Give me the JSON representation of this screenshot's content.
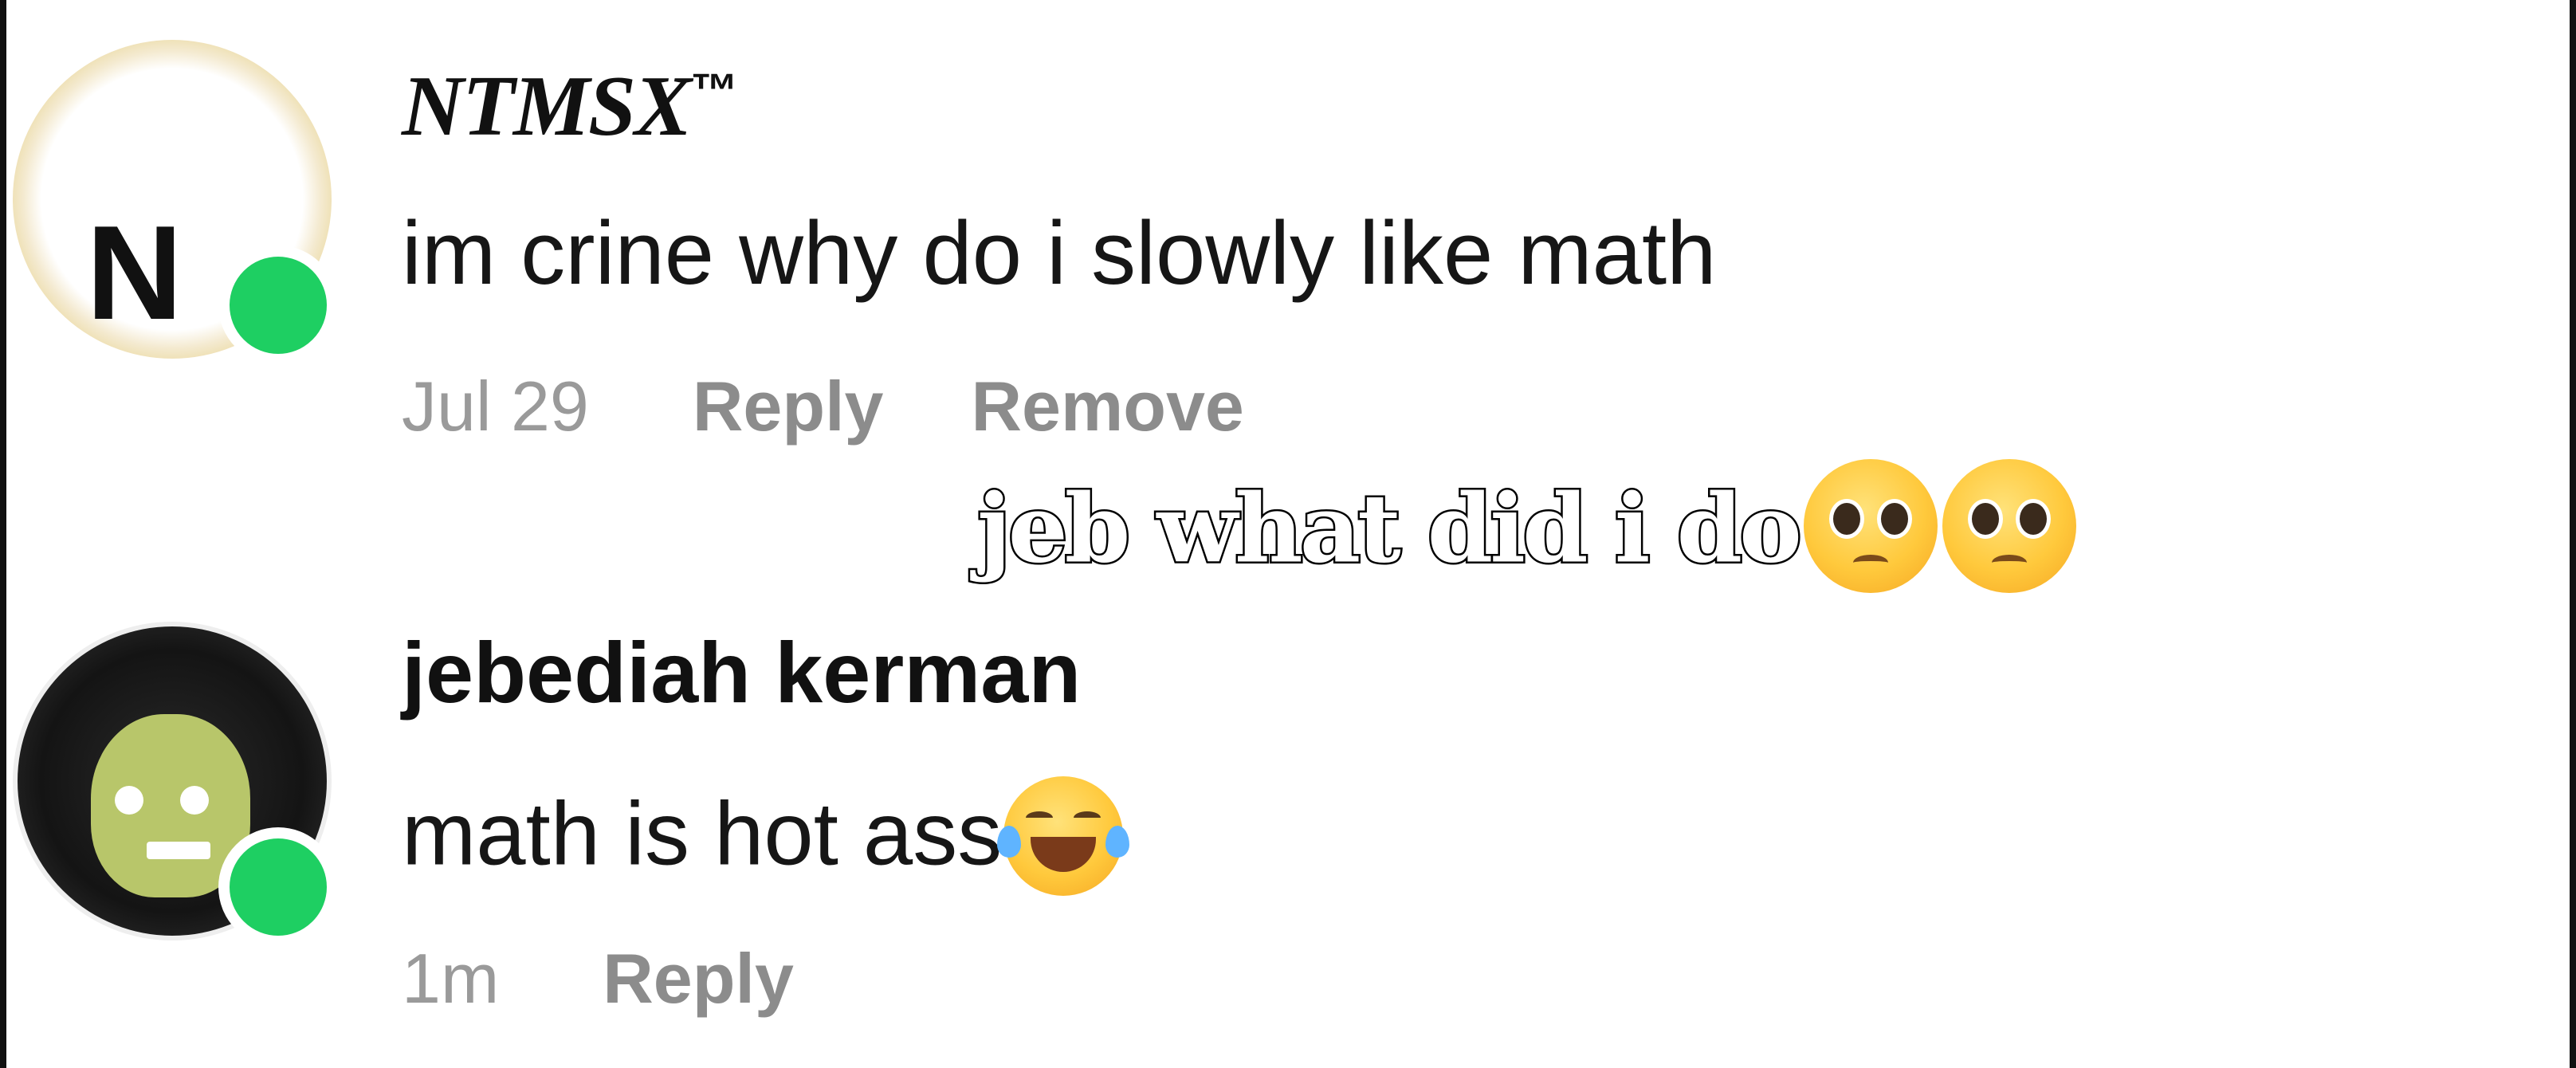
{
  "comments": [
    {
      "username": "NTMSX",
      "username_mark": "™",
      "avatar_icon": "n-logo-avatar",
      "avatar_letter": "N",
      "online": true,
      "text": "im crine why do i slowly like math",
      "time": "Jul 29",
      "actions": [
        "Reply",
        "Remove"
      ]
    },
    {
      "username": "jebediah kerman",
      "avatar_icon": "kerbal-avatar",
      "online": true,
      "text": "math is hot ass",
      "text_emoji": "face-with-tears-of-joy-icon",
      "time": "1m",
      "actions": [
        "Reply"
      ]
    }
  ],
  "overlay": {
    "caption": "jeb what did i do",
    "emojis": [
      "pleading-face-icon",
      "pleading-face-icon"
    ]
  },
  "colors": {
    "online_dot": "#1ecf62",
    "meta_text": "#9a9a9a",
    "action_text": "#8c8c8c",
    "username_text": "#111111"
  }
}
